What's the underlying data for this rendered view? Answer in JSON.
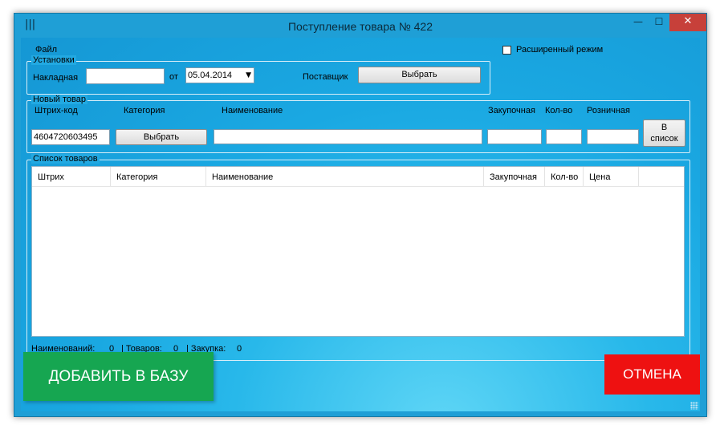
{
  "window": {
    "title": "Поступление товара № 422",
    "minimize_glyph": "—",
    "maximize_glyph": "☐",
    "close_glyph": "✕",
    "app_icon": "barcode-icon",
    "app_icon_glyph": "|||"
  },
  "menu": {
    "file_label": "Файл"
  },
  "settings": {
    "group_title": "Установки",
    "invoice_label": "Накладная",
    "invoice_value": "",
    "date_prefix": "от",
    "date_value": "05.04.2014",
    "supplier_label": "Поставщик",
    "supplier_button": "Выбрать"
  },
  "advanced_mode": {
    "label": "Расширенный режим",
    "checked": false
  },
  "new_item": {
    "group_title": "Новый товар",
    "barcode_label": "Штрих-код",
    "barcode_value": "4604720603495",
    "category_label": "Категория",
    "category_button": "Выбрать",
    "name_label": "Наименование",
    "name_value": "",
    "purchase_label": "Закупочная",
    "purchase_value": "",
    "qty_label": "Кол-во",
    "qty_value": "",
    "retail_label": "Розничная",
    "retail_value": "",
    "add_to_list_line1": "В",
    "add_to_list_line2": "список"
  },
  "goods_list": {
    "group_title": "Список товаров",
    "columns": [
      "Штрих",
      "Категория",
      "Наименование",
      "Закупочная",
      "Кол-во",
      "Цена"
    ],
    "rows": []
  },
  "summary": {
    "names_label": "Наименований:",
    "names_value": "0",
    "goods_label": "| Товаров:",
    "goods_value": "0",
    "purchase_label": "| Закупка:",
    "purchase_value": "0"
  },
  "actions": {
    "add_to_db": "ДОБАВИТЬ В БАЗУ",
    "cancel": "ОТМЕНА"
  },
  "colors": {
    "window_blue": "#1f9fd6",
    "add_green": "#16a651",
    "cancel_red": "#ee1111",
    "close_red": "#c7403a"
  }
}
